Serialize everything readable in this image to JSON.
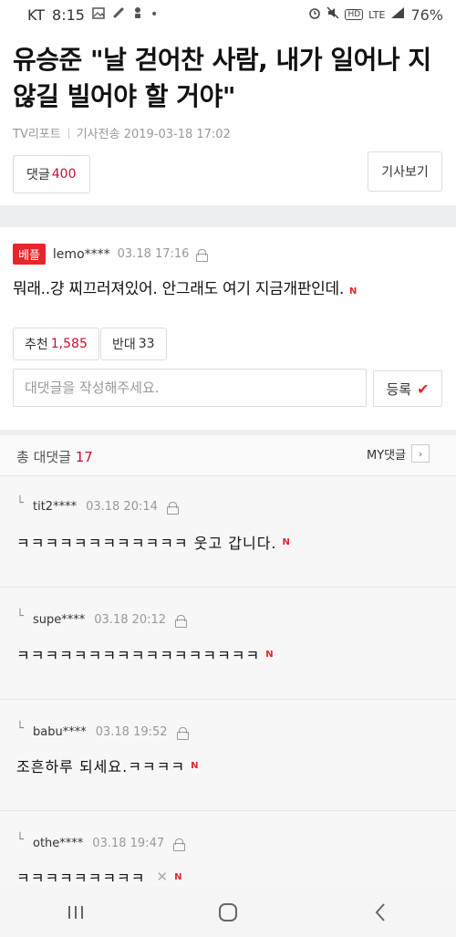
{
  "status_bar": {
    "carrier": "KT",
    "time": "8:15",
    "network": "LTE",
    "battery": "76%"
  },
  "article": {
    "title": "유승준 \"날 걷어찬 사람, 내가 일어나 지 않길 빌어야 할 거야\"",
    "source": "TV리포트",
    "published": "기사전송 2019-03-18 17:02",
    "comments_label": "댓글",
    "comments_count": "400",
    "view_article_label": "기사보기"
  },
  "best_comment": {
    "badge": "베플",
    "user": "lemo****",
    "date": "03.18 17:16",
    "text": "뭐래..걍 찌끄러져있어. 안그래도 여기 지금개판인데.",
    "new_mark": "N",
    "upvote_label": "추천",
    "upvote_count": "1,585",
    "downvote_label": "반대",
    "downvote_count": "33",
    "reply_placeholder": "대댓글을 작성해주세요.",
    "submit_label": "등록"
  },
  "replies": {
    "header_label": "총 대댓글",
    "count": "17",
    "my_replies_label": "MY댓글",
    "items": [
      {
        "user": "tit2****",
        "date": "03.18 20:14",
        "text": "ㅋㅋㅋㅋㅋㅋㅋㅋㅋㅋㅋㅋ 웃고 갑니다.",
        "new_mark": "N"
      },
      {
        "user": "supe****",
        "date": "03.18 20:12",
        "text": "ㅋㅋㅋㅋㅋㅋㅋㅋㅋㅋㅋㅋㅋㅋㅋㅋㅋ",
        "new_mark": "N"
      },
      {
        "user": "babu****",
        "date": "03.18 19:52",
        "text": "조흔하루 되세요.ㅋㅋㅋㅋ",
        "new_mark": "N"
      },
      {
        "user": "othe****",
        "date": "03.18 19:47",
        "text": "ㅋㅋㅋㅋㅋㅋㅋㅋㅋ",
        "new_mark": "N"
      }
    ]
  },
  "colors": {
    "accent": "#e8252a",
    "count_red": "#c8102e",
    "gap_gray": "#eceef2"
  }
}
